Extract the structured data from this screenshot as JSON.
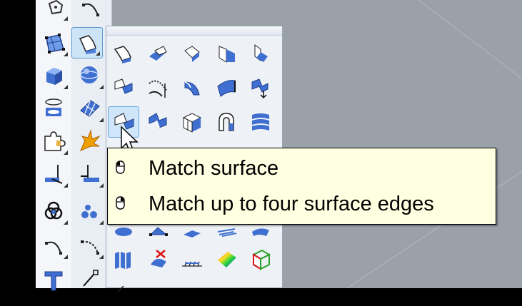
{
  "toolbar": {
    "active_button": "surface-tools",
    "items": [
      {
        "name": "polygon",
        "icon": "polygon-icon"
      },
      {
        "name": "arc",
        "icon": "arc-icon"
      },
      {
        "name": "control-point-surface",
        "icon": "control-point-surface-icon"
      },
      {
        "name": "surface-tools",
        "icon": "surface-tools-icon"
      },
      {
        "name": "box",
        "icon": "box-icon"
      },
      {
        "name": "sphere",
        "icon": "sphere-icon"
      },
      {
        "name": "cylinder",
        "icon": "cylinder-icon"
      },
      {
        "name": "mesh-plane",
        "icon": "mesh-plane-icon"
      },
      {
        "name": "puzzle-tools",
        "icon": "puzzle-icon"
      },
      {
        "name": "explode",
        "icon": "explode-icon"
      },
      {
        "name": "extend-left",
        "icon": "extend-icon"
      },
      {
        "name": "extend-right",
        "icon": "extend-icon"
      },
      {
        "name": "boolean",
        "icon": "boolean-icon"
      },
      {
        "name": "spheres",
        "icon": "spheres-icon"
      },
      {
        "name": "curve",
        "icon": "curve-icon"
      },
      {
        "name": "curve-points",
        "icon": "curve-points-icon"
      },
      {
        "name": "text",
        "icon": "text-icon"
      },
      {
        "name": "point",
        "icon": "point-icon"
      }
    ]
  },
  "flyout": {
    "active": "match-surface",
    "items": [
      "surface-from-points-icon",
      "surface-from-edge-icon",
      "surface-corner-icon",
      "surface-from-planar-curves-icon",
      "surface-vertical-icon",
      "extrude-surface-icon",
      "revolve-surface-icon",
      "blend-surface-icon",
      "sweep-surface-icon",
      "loft-surface-icon",
      "match-surface-icon",
      "merge-surface-icon",
      "unroll-surface-icon",
      "network-surface-icon",
      "patch-surface-icon",
      "offset-surface-icon",
      "fillet-surface-icon",
      "planar-surface-icon",
      "sweep-two-rail-icon",
      "edge-surface-icon",
      "developable-surface-icon",
      "trim-surface-icon",
      "heightfield-icon",
      "curvature-icon",
      "box-edit-icon"
    ]
  },
  "tooltip": {
    "left_click_label": "Match surface",
    "right_click_label": "Match up to four surface edges",
    "left_icon": "left-mouse-icon",
    "right_icon": "right-mouse-icon"
  },
  "colors": {
    "viewport": "#9aa1a9",
    "toolbar": "#e9eef5",
    "tooltip_bg": "#ffffe1",
    "icon_blue": "#3f6fd0"
  }
}
